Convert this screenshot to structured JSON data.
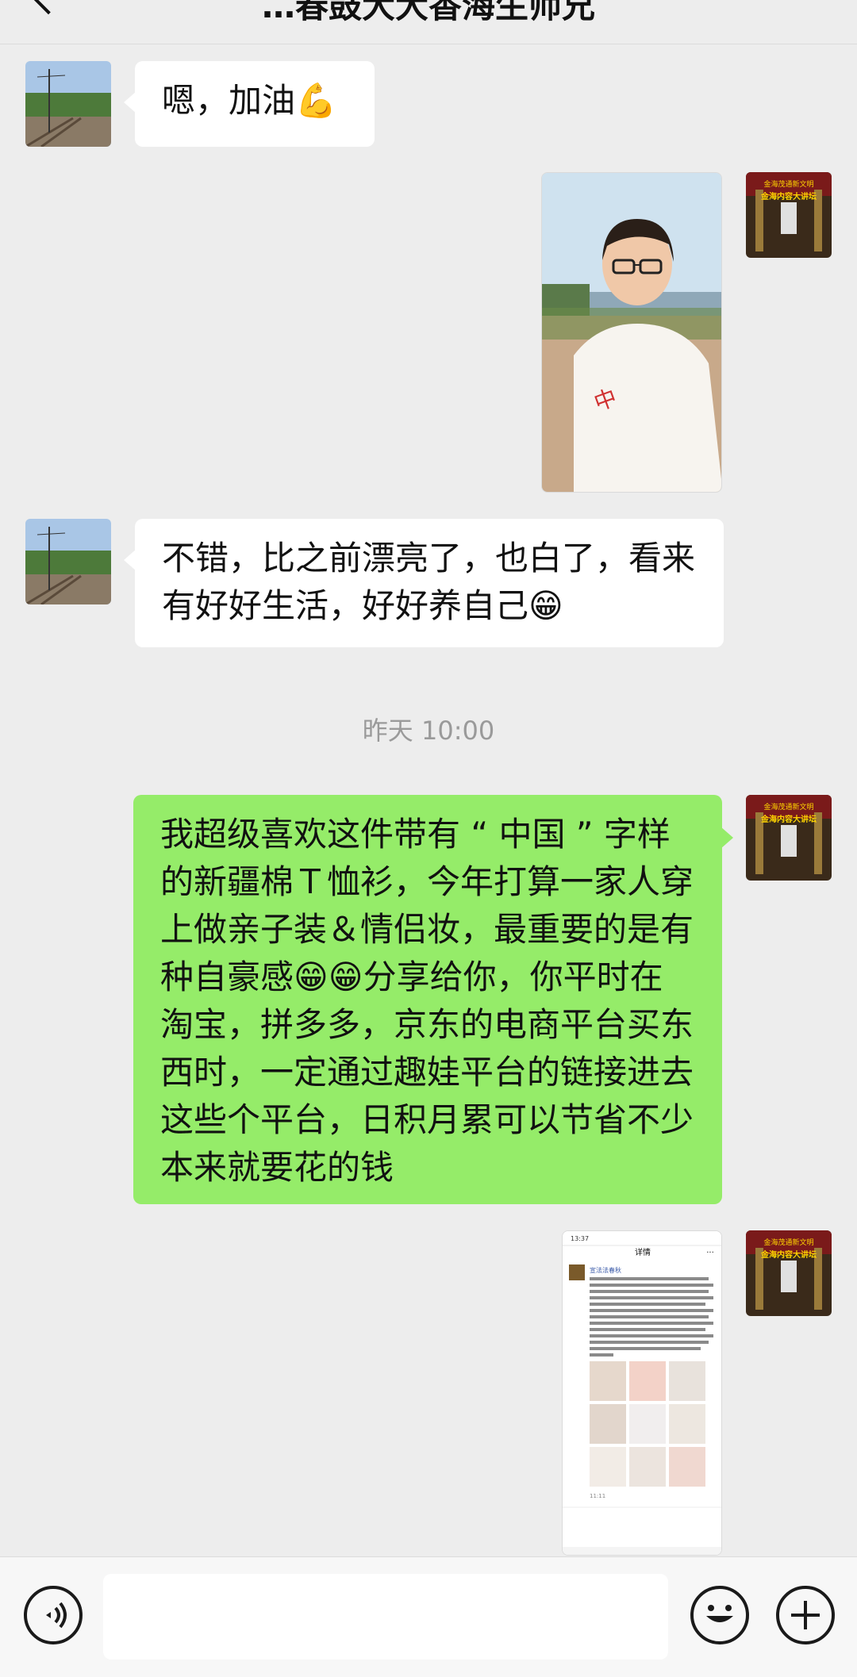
{
  "header": {
    "title": "…春鼓大大香海生师兄"
  },
  "messages": [
    {
      "id": "m1",
      "sender": "friend",
      "type": "text",
      "text": "嗯，加油💪"
    },
    {
      "id": "m2",
      "sender": "me",
      "type": "image",
      "description": "selfie-photo"
    },
    {
      "id": "m3",
      "sender": "friend",
      "type": "text",
      "text": "不错，比之前漂亮了，也白了，看来有好好生活，好好养自己😁"
    },
    {
      "id": "m4",
      "sender": "system",
      "type": "time",
      "text": "昨天 10:00"
    },
    {
      "id": "m5",
      "sender": "me",
      "type": "text",
      "text": "我超级喜欢这件带有 “ 中国 ” 字样的新疆棉Ｔ恤衫，今年打算一家人穿上做亲子装＆情侣妆，最重要的是有种自豪感😁😁分享给你，你平时在淘宝，拼多多，京东的电商平台买东西时，一定通过趣娃平台的链接进去这些个平台，日积月累可以节省不少本来就要花的钱"
    },
    {
      "id": "m6",
      "sender": "me",
      "type": "image",
      "description": "screenshot"
    }
  ],
  "avatar_text": {
    "line1": "金海茂通新文明",
    "line2": "金海内容大讲坛"
  },
  "screenshot_thumb": {
    "status_time": "13:37",
    "header": "详情",
    "more": "···",
    "author": "宣法法春秋",
    "footer_time": "11:11"
  },
  "colors": {
    "background": "#ededed",
    "my_bubble": "#95ec69",
    "friend_bubble": "#ffffff",
    "timestamp": "#9a9a9a"
  },
  "icons": {
    "voice": "voice-icon",
    "emoji": "emoji-icon",
    "plus": "plus-icon",
    "back": "back-icon"
  }
}
